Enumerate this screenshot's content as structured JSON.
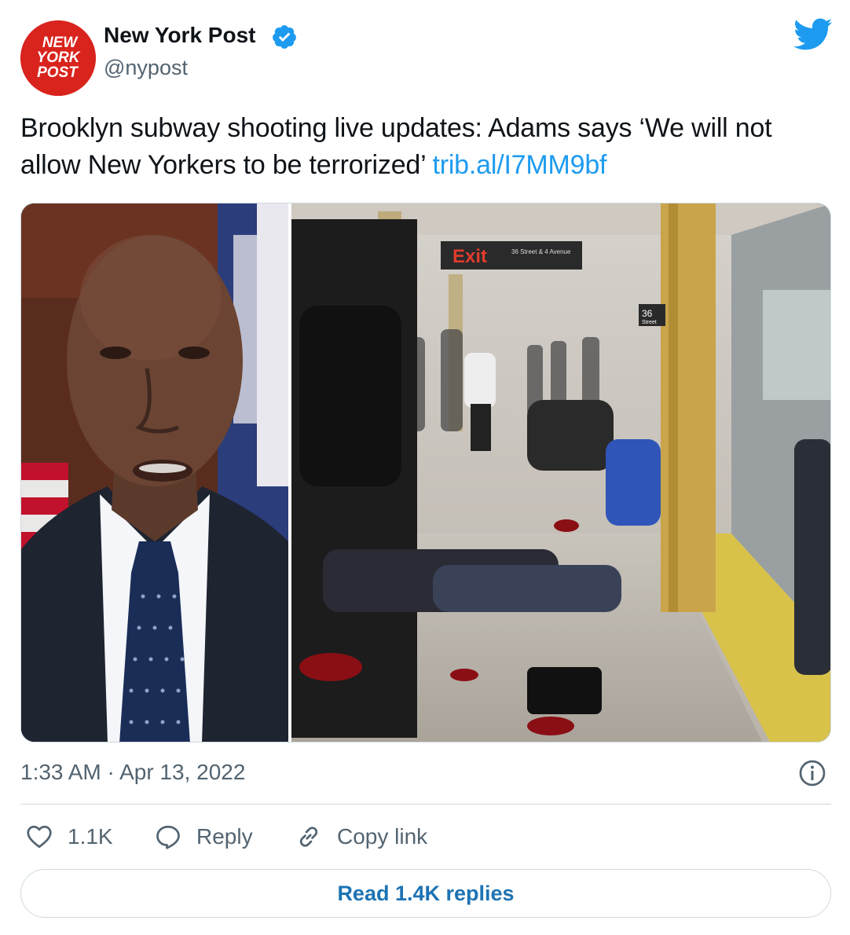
{
  "author": {
    "display_name": "New York Post",
    "handle": "@nypost",
    "avatar_logo_text": [
      "NEW",
      "YORK",
      "POST"
    ],
    "verified": true
  },
  "tweet": {
    "text": "Brooklyn subway shooting live updates: Adams says ‘We will not allow New Yorkers to be terrorized’",
    "link": "trib.al/I7MM9bf",
    "timestamp": "1:33 AM · Apr 13, 2022"
  },
  "media": {
    "photo_left": "portrait of Mayor Adams in suit in front of flags",
    "photo_right": "smoke-filled subway platform with injured people",
    "signs": {
      "exit": "Exit",
      "exit_sub": "36 Street & 4 Avenue",
      "station_num": "36",
      "station_word": "Street"
    }
  },
  "actions": {
    "like_count": "1.1K",
    "reply_label": "Reply",
    "copy_label": "Copy link"
  },
  "read_replies_label": "Read 1.4K replies",
  "colors": {
    "link": "#1d9bf0",
    "verified": "#1d9bf0",
    "avatar_bg": "#d9231d",
    "muted": "#536471",
    "read_replies": "#1d73b3"
  }
}
